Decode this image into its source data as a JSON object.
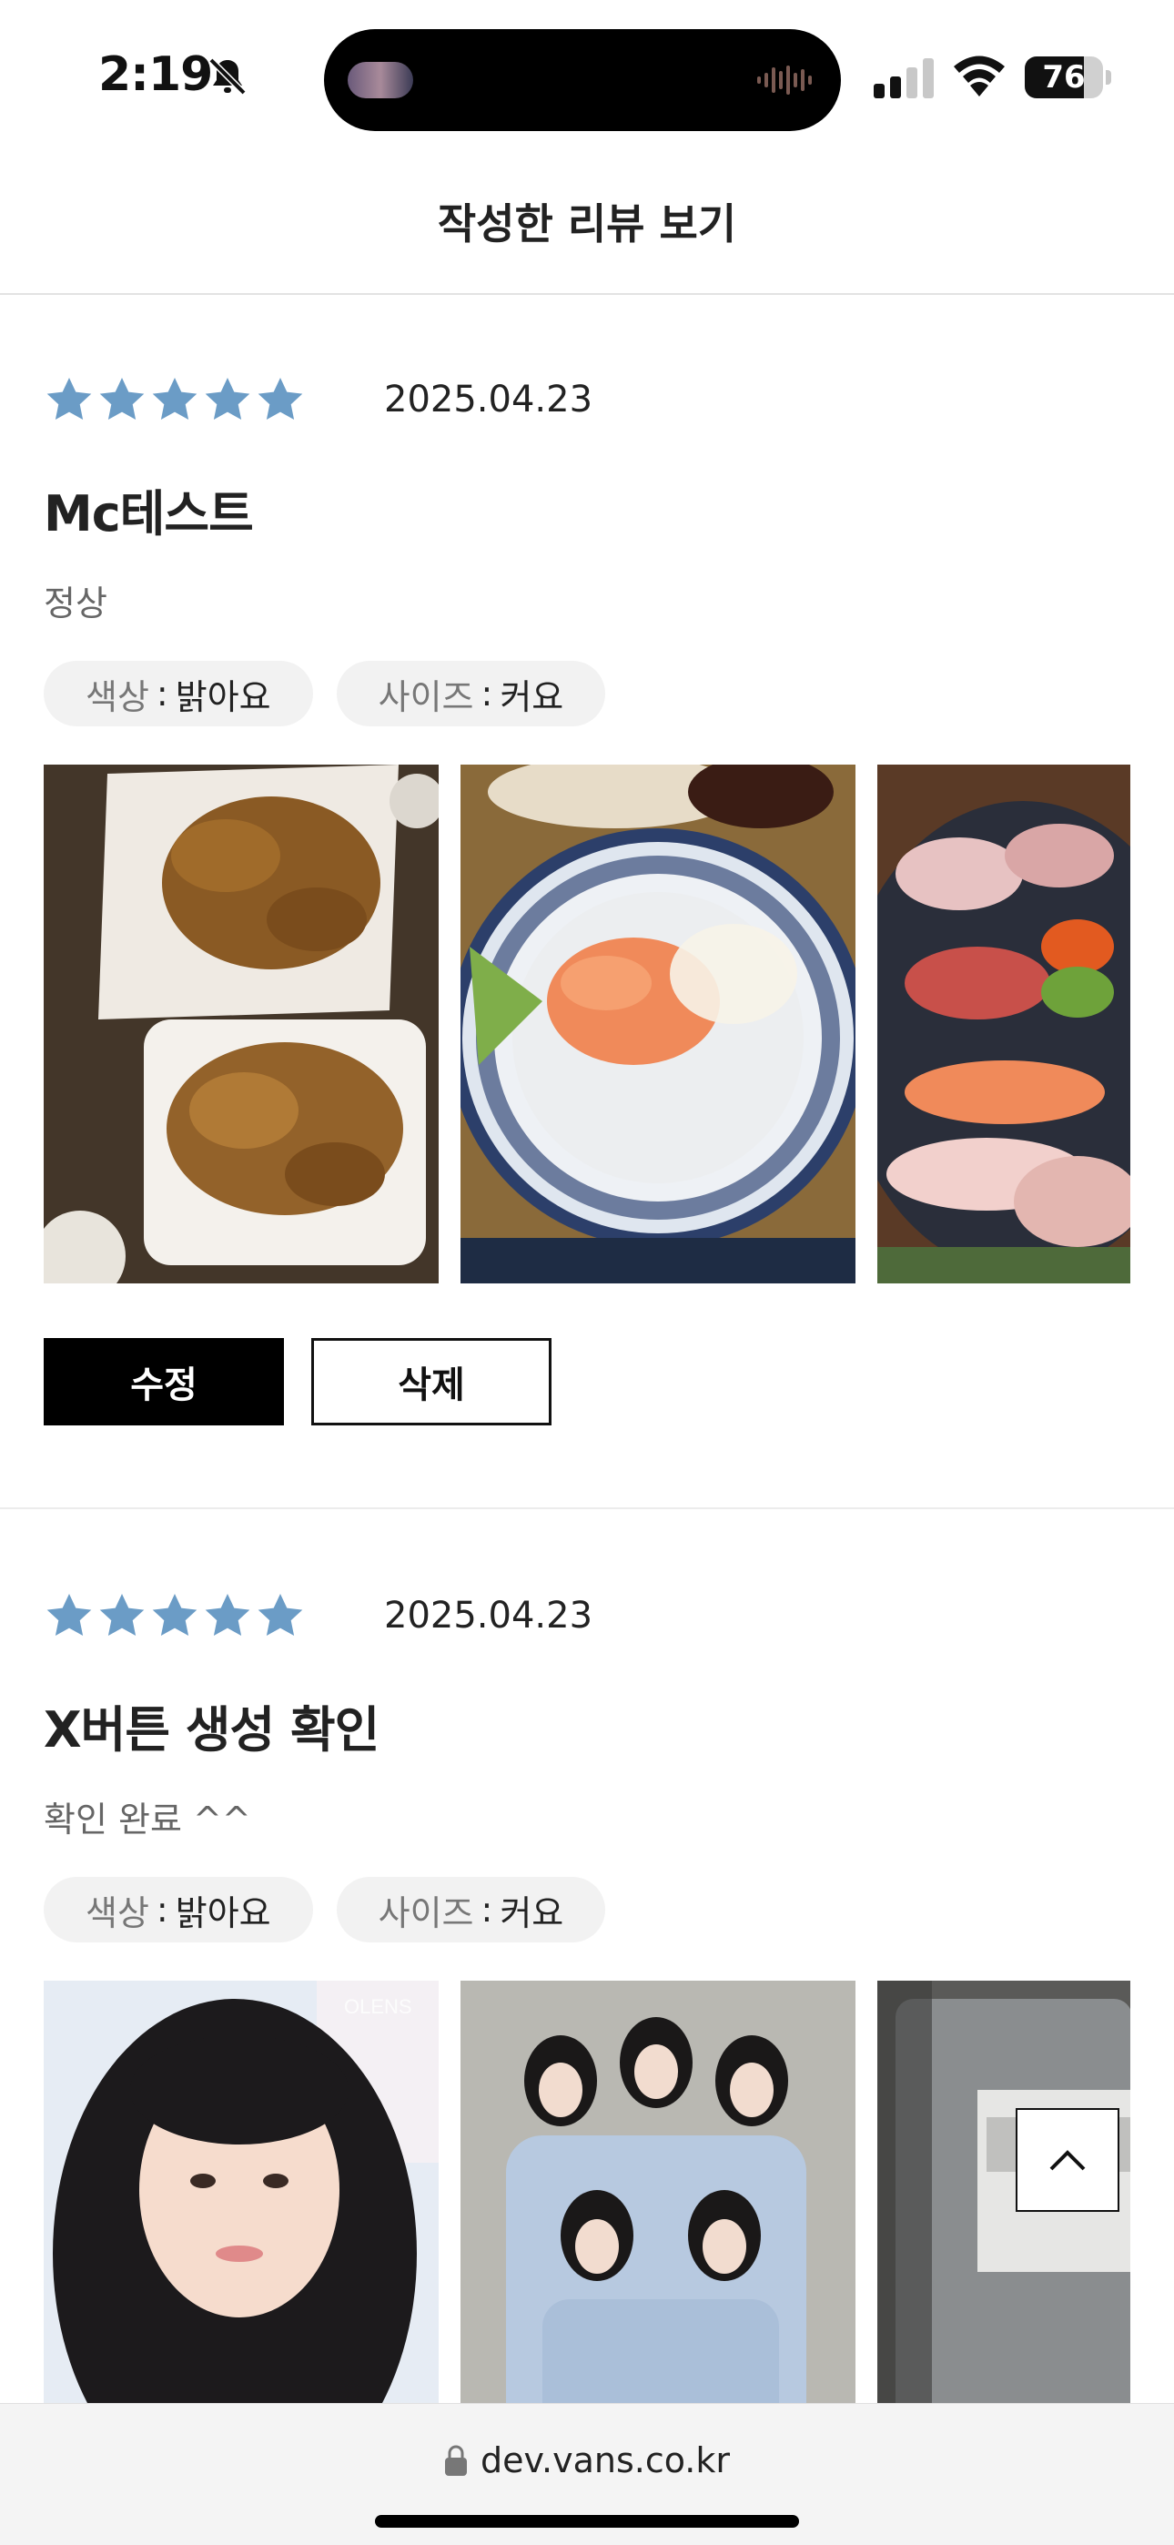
{
  "status": {
    "time": "2:19",
    "battery": "76",
    "battery_level": 0.76
  },
  "header": {
    "title": "작성한 리뷰 보기"
  },
  "colors": {
    "star": "#6b9cc6",
    "button_primary": "#000000"
  },
  "reviews": [
    {
      "rating": 5,
      "date": "2025.04.23",
      "title": "Mc테스트",
      "body": "정상",
      "chips": [
        {
          "key": "색상",
          "sep": ":",
          "value": "밝아요"
        },
        {
          "key": "사이즈",
          "sep": ":",
          "value": "커요"
        }
      ],
      "photos": [
        "fried-chicken-photo",
        "salmon-bowl-photo",
        "sashimi-platter-photo"
      ],
      "edit_label": "수정",
      "delete_label": "삭제"
    },
    {
      "rating": 5,
      "date": "2025.04.23",
      "title": "X버튼 생성 확인",
      "body": "확인 완료 ^^",
      "chips": [
        {
          "key": "색상",
          "sep": ":",
          "value": "밝아요"
        },
        {
          "key": "사이즈",
          "sep": ":",
          "value": "커요"
        }
      ],
      "photos": [
        "portrait-photo",
        "group-photo",
        "glass-photo"
      ],
      "photo_watermark": "OLENS"
    }
  ],
  "scroll_top_icon": "chevron-up-icon",
  "browser": {
    "url": "dev.vans.co.kr"
  }
}
